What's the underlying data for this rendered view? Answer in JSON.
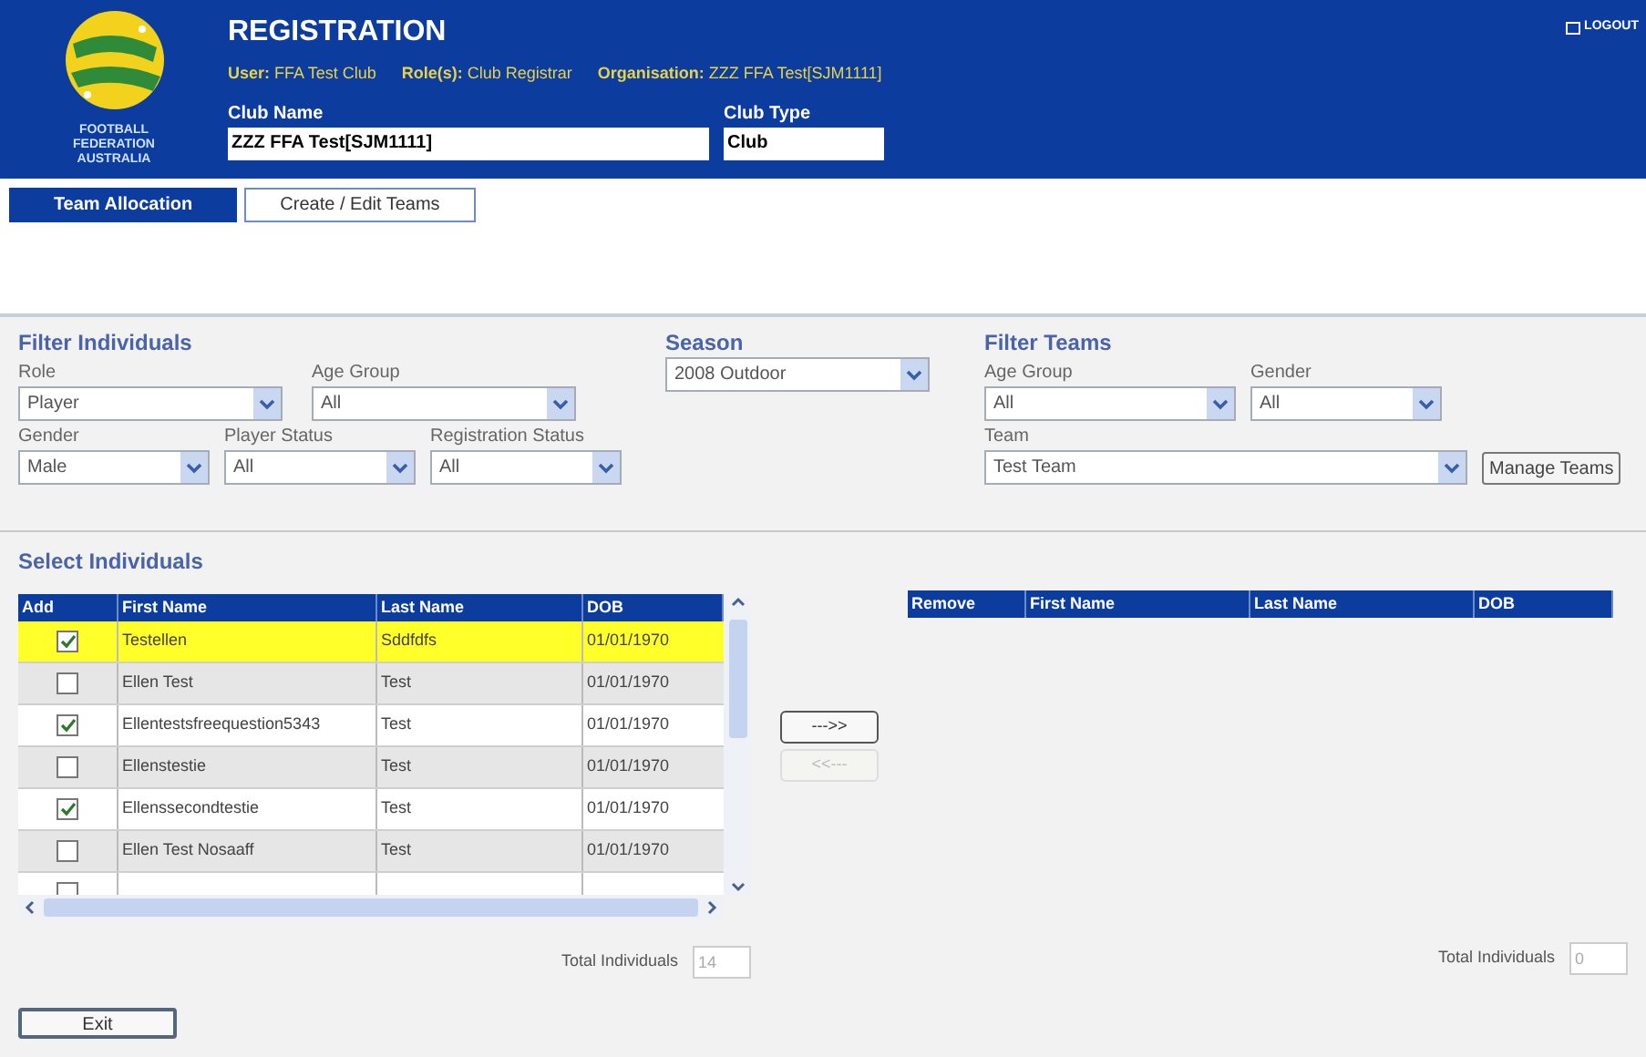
{
  "header": {
    "title": "REGISTRATION",
    "logo_lines": [
      "FOOTBALL",
      "FEDERATION",
      "AUSTRALIA"
    ],
    "logout": "LOGOUT",
    "info": [
      "**User:** FFA Test Club",
      "**Role(s):** Club Registrar",
      "**Organisation:** ZZZ FFA Test[SJM1111]"
    ],
    "fields": [
      {
        "label": "Club Name",
        "value": "ZZZ FFA Test[SJM1111]"
      },
      {
        "label": "Club Type",
        "value": "Club"
      }
    ]
  },
  "tabs": [
    {
      "label": "Team Allocation",
      "selected": true
    },
    {
      "label": "Create / Edit Teams",
      "selected": false
    }
  ],
  "filter_individuals": {
    "title": "Filter Individuals",
    "rows": [
      [
        {
          "label": "Role",
          "value": "Player"
        },
        {
          "label": "Age Group",
          "value": "All"
        }
      ],
      [
        {
          "label": "Gender",
          "value": "Male"
        },
        {
          "label": "Player Status",
          "value": "All"
        },
        {
          "label": "Registration Status",
          "value": "All"
        }
      ]
    ]
  },
  "season": {
    "label": "Season",
    "value": "2008 Outdoor"
  },
  "filter_teams": {
    "title": "Filter Teams",
    "rows": [
      [
        {
          "label": "Age Group",
          "value": "All"
        },
        {
          "label": "Gender",
          "value": "All"
        }
      ],
      [
        {
          "label": "Team",
          "value": "Test Team"
        }
      ]
    ],
    "manage_button": "Manage Teams"
  },
  "select_individuals": {
    "title": "Select Individuals",
    "columns": [
      "Add",
      "First Name",
      "Last Name",
      "DOB"
    ],
    "rows": [
      {
        "checked": true,
        "selected": true,
        "first_name": "Testellen",
        "last_name": "Sddfdfs",
        "dob": "01/01/1970"
      },
      {
        "checked": false,
        "selected": false,
        "first_name": "Ellen Test",
        "last_name": "Test",
        "dob": "01/01/1970"
      },
      {
        "checked": true,
        "selected": false,
        "first_name": "Ellentestsfreequestion5343",
        "last_name": "Test",
        "dob": "01/01/1970"
      },
      {
        "checked": false,
        "selected": false,
        "first_name": "Ellenstestie",
        "last_name": "Test",
        "dob": "01/01/1970"
      },
      {
        "checked": true,
        "selected": false,
        "first_name": "Ellenssecondtestie",
        "last_name": "Test",
        "dob": "01/01/1970"
      },
      {
        "checked": false,
        "selected": false,
        "first_name": "Ellen Test Nosaaff",
        "last_name": "Test",
        "dob": "01/01/1970"
      },
      {
        "checked": false,
        "selected": false
      }
    ],
    "total_label": "Total Individuals",
    "total_value": "14"
  },
  "move_buttons": [
    {
      "label": "--->>",
      "disabled": false
    },
    {
      "label": "<<---",
      "disabled": true
    }
  ],
  "team_table": {
    "columns": [
      "Remove",
      "First Name",
      "Last Name",
      "DOB"
    ],
    "total_label": "Total Individuals",
    "total_value": "0"
  },
  "exit_button": "Exit"
}
